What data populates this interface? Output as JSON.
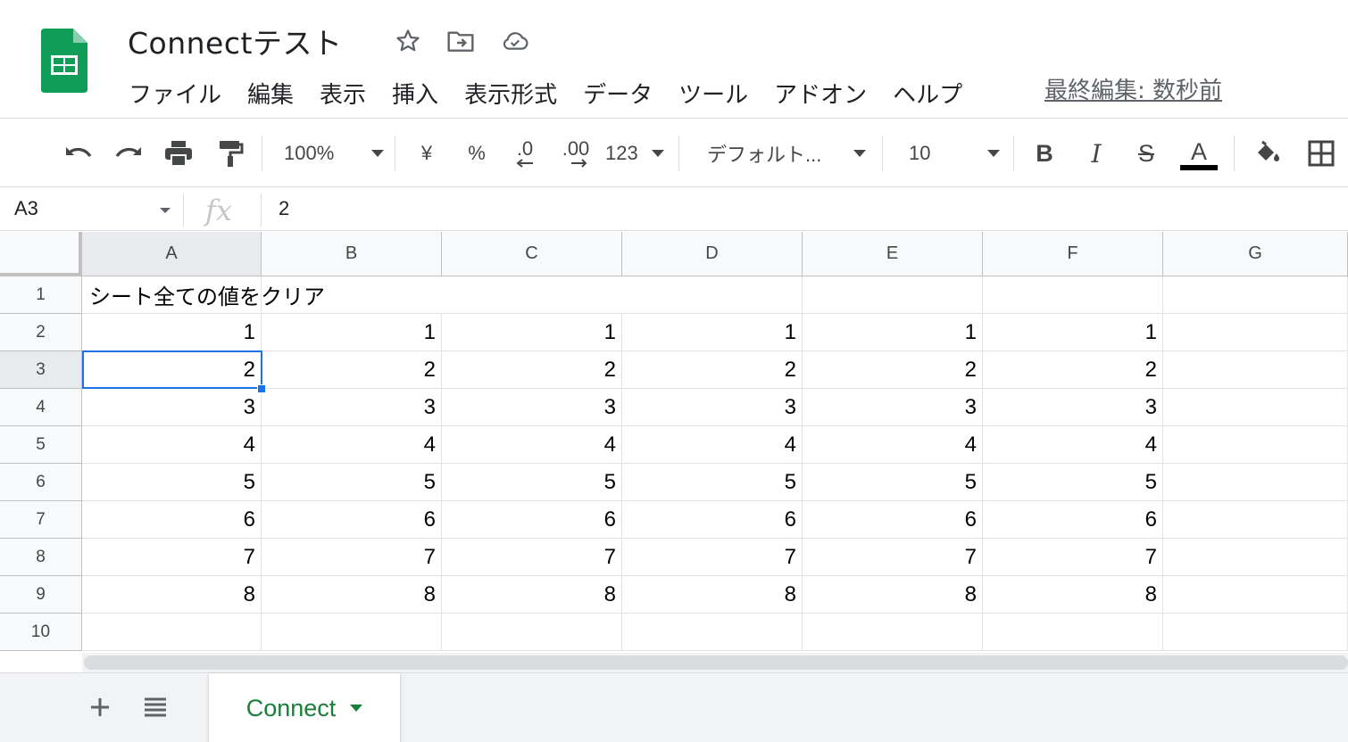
{
  "app": {
    "name": "Google Sheets",
    "brand_color": "#0f9d58"
  },
  "document": {
    "title": "Connectテスト"
  },
  "title_icons": [
    "star-icon",
    "move-to-folder-icon",
    "cloud-saved-icon"
  ],
  "menu": [
    "ファイル",
    "編集",
    "表示",
    "挿入",
    "表示形式",
    "データ",
    "ツール",
    "アドオン",
    "ヘルプ"
  ],
  "last_edit": "最終編集: 数秒前",
  "toolbar": {
    "zoom": "100%",
    "currency": "¥",
    "percent": "%",
    "decrease_decimal": ".0",
    "increase_decimal": ".00",
    "more_formats": "123",
    "font": "デフォルト...",
    "font_size": "10",
    "bold": "B",
    "italic": "I",
    "strike": "S",
    "text_color": "A"
  },
  "formula_bar": {
    "cell_ref": "A3",
    "fx": "fx",
    "value": "2"
  },
  "grid": {
    "columns": [
      "A",
      "B",
      "C",
      "D",
      "E",
      "F",
      "G"
    ],
    "row_numbers": [
      "1",
      "2",
      "3",
      "4",
      "5",
      "6",
      "7",
      "8",
      "9",
      "10"
    ],
    "row1_text": "シート全ての値をクリア",
    "rows": [
      [
        "1",
        "1",
        "1",
        "1",
        "1",
        "1"
      ],
      [
        "2",
        "2",
        "2",
        "2",
        "2",
        "2"
      ],
      [
        "3",
        "3",
        "3",
        "3",
        "3",
        "3"
      ],
      [
        "4",
        "4",
        "4",
        "4",
        "4",
        "4"
      ],
      [
        "5",
        "5",
        "5",
        "5",
        "5",
        "5"
      ],
      [
        "6",
        "6",
        "6",
        "6",
        "6",
        "6"
      ],
      [
        "7",
        "7",
        "7",
        "7",
        "7",
        "7"
      ],
      [
        "8",
        "8",
        "8",
        "8",
        "8",
        "8"
      ]
    ],
    "selected_cell": "A3",
    "selection_color": "#1a73e8"
  },
  "sheet_tabs": {
    "active": "Connect",
    "active_color": "#188038"
  }
}
